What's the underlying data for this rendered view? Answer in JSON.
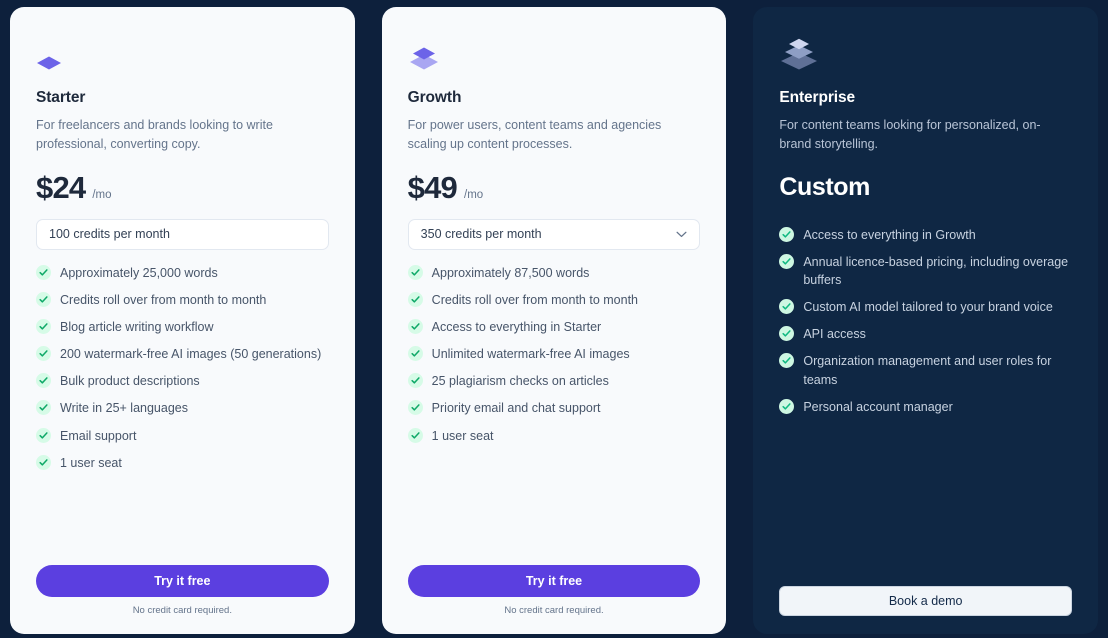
{
  "theme": {
    "page_background": "#0d203c",
    "light_card_background": "#f8fafc",
    "dark_card_background": "#0f2744",
    "accent_purple": "#5b3fe0",
    "icon_purple": "#6c63e8",
    "check_green": "#10b981",
    "check_bubble_light": "#d6fbe7"
  },
  "plans": [
    {
      "id": "starter",
      "icon": "layers-1-icon",
      "name": "Starter",
      "description": "For freelancers and brands looking to write professional, converting copy.",
      "price": "$24",
      "period": "/mo",
      "credits": {
        "type": "input",
        "value": "100 credits per month"
      },
      "features": [
        "Approximately 25,000 words",
        "Credits roll over from month to month",
        "Blog article writing workflow",
        "200 watermark-free AI images (50 generations)",
        "Bulk product descriptions",
        "Write in 25+ languages",
        "Email support",
        "1 user seat"
      ],
      "cta": {
        "label": "Try it free",
        "style": "primary",
        "note": "No credit card required."
      }
    },
    {
      "id": "growth",
      "icon": "layers-2-icon",
      "name": "Growth",
      "description": "For power users, content teams and agencies scaling up content processes.",
      "price": "$49",
      "period": "/mo",
      "credits": {
        "type": "select",
        "value": "350 credits per month"
      },
      "features": [
        "Approximately 87,500 words",
        "Credits roll over from month to month",
        "Access to everything in Starter",
        "Unlimited watermark-free AI images",
        "25 plagiarism checks on articles",
        "Priority email and chat support",
        "1 user seat"
      ],
      "cta": {
        "label": "Try it free",
        "style": "primary",
        "note": "No credit card required."
      }
    },
    {
      "id": "enterprise",
      "icon": "layers-3-icon",
      "name": "Enterprise",
      "description": "For content teams looking for personalized, on-brand storytelling.",
      "price": "Custom",
      "period": "",
      "credits": null,
      "features": [
        "Access to everything in Growth",
        "Annual licence-based pricing, including overage buffers",
        "Custom AI model tailored to your brand voice",
        "API access",
        "Organization management and user roles for teams",
        "Personal account manager"
      ],
      "cta": {
        "label": "Book a demo",
        "style": "light",
        "note": ""
      }
    }
  ]
}
